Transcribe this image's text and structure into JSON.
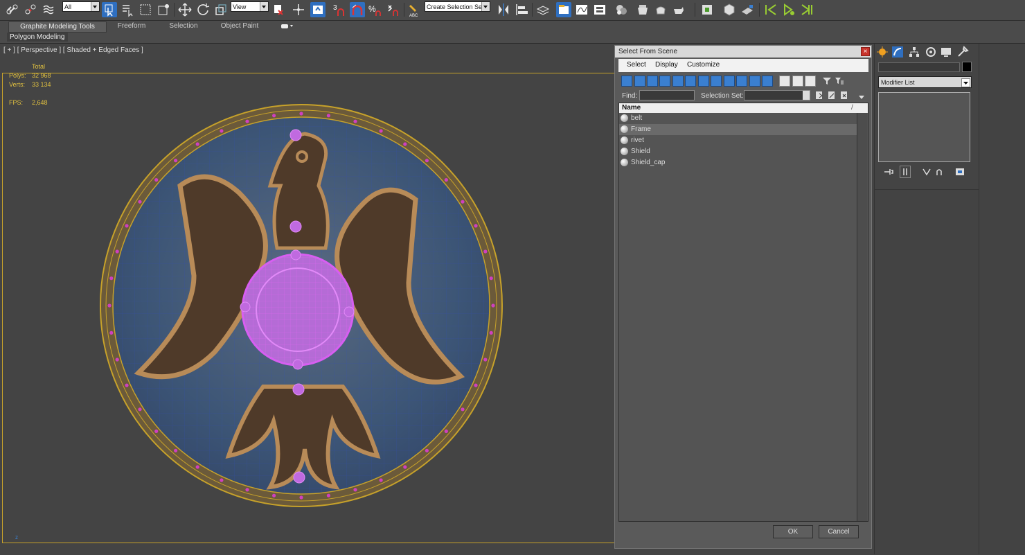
{
  "toolbar": {
    "selection_filter": "All",
    "reference_coord": "View",
    "named_selection": "Create Selection Se"
  },
  "ribbon": {
    "tabs": [
      "Graphite Modeling Tools",
      "Freeform",
      "Selection",
      "Object Paint"
    ],
    "sub_label": "Polygon Modeling"
  },
  "viewport": {
    "label": "[ + ] [ Perspective ] [ Shaded + Edged Faces ]",
    "stats": {
      "total_label": "Total",
      "polys_label": "Polys:",
      "polys_value": "32 968",
      "verts_label": "Verts:",
      "verts_value": "33 134",
      "fps_label": "FPS:",
      "fps_value": "2,648"
    },
    "colors": {
      "frame": "#c7a22a",
      "selection_wire": "#cc55ee",
      "shield_blue": "#3c5576",
      "emblem_brown": "#4f3a29"
    }
  },
  "dialog": {
    "title": "Select From Scene",
    "menu": [
      "Select",
      "Display",
      "Customize"
    ],
    "find_label": "Find:",
    "find_value": "",
    "selection_set_label": "Selection Set:",
    "selection_set_value": "",
    "column_header": "Name",
    "objects": [
      {
        "name": "belt",
        "selected": false
      },
      {
        "name": "Frame",
        "selected": true
      },
      {
        "name": "rivet",
        "selected": false
      },
      {
        "name": "Shield",
        "selected": false
      },
      {
        "name": "Shield_cap",
        "selected": false
      }
    ],
    "ok_label": "OK",
    "cancel_label": "Cancel"
  },
  "command_panel": {
    "object_name": "",
    "modifier_list": "Modifier List"
  },
  "bottom_marker": "z"
}
